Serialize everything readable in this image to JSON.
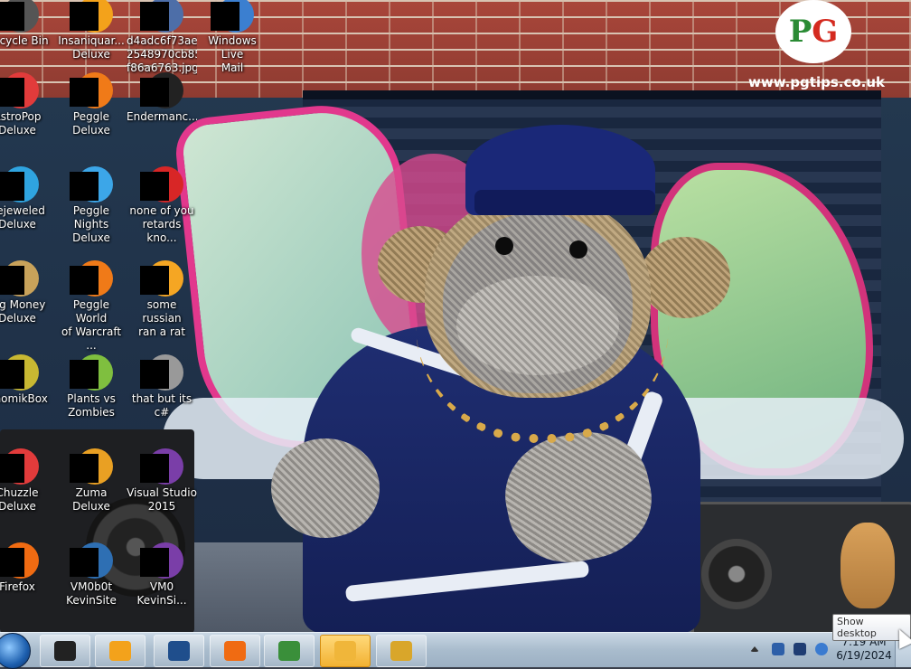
{
  "wallpaper": {
    "brand_logo_text": "PG tips",
    "brand_url": "www.pgtips.co.uk"
  },
  "desktop_icons": [
    {
      "label": "Recycle Bin",
      "icon": "recycle-bin-icon",
      "color": "#555555"
    },
    {
      "label": "Insaniquar...\nDeluxe",
      "icon": "insaniquarium-icon",
      "color": "#f3a21b"
    },
    {
      "label": "d4adc6f73ae5\n2548970cb85d\nf86a6763.jpg",
      "icon": "image-file-icon",
      "color": "#4d6ea8"
    },
    {
      "label": "Windows Live\nMail",
      "icon": "mail-icon",
      "color": "#3b7fd0"
    },
    {
      "label": "AstroPop\nDeluxe",
      "icon": "astropop-icon",
      "color": "#e23b3b"
    },
    {
      "label": "Peggle Deluxe",
      "icon": "peggle-icon",
      "color": "#f07a18"
    },
    {
      "label": "Endermanc...",
      "icon": "console-icon",
      "color": "#222222"
    },
    {
      "label": "Bejeweled\nDeluxe",
      "icon": "bejeweled-icon",
      "color": "#2fa4e0"
    },
    {
      "label": "Peggle Nights\nDeluxe",
      "icon": "peggle-nights-icon",
      "color": "#3ca6e8"
    },
    {
      "label": "none of you\nretards kno...",
      "icon": "opera-icon",
      "color": "#d82626"
    },
    {
      "label": "Big Money\nDeluxe",
      "icon": "big-money-icon",
      "color": "#c8a25a"
    },
    {
      "label": "Peggle World\nof Warcraft ...",
      "icon": "peggle-wow-icon",
      "color": "#f07a18"
    },
    {
      "label": "some russian\nran a rat",
      "icon": "script-file-icon",
      "color": "#f5a623"
    },
    {
      "label": "ChomikBox",
      "icon": "chomikbox-icon",
      "color": "#c8b832"
    },
    {
      "label": "Plants vs\nZombies",
      "icon": "pvz-icon",
      "color": "#7fbf3f"
    },
    {
      "label": "that but its c#",
      "icon": "files-icon",
      "color": "#999999"
    },
    {
      "label": "Chuzzle\nDeluxe",
      "icon": "chuzzle-icon",
      "color": "#e23b3b"
    },
    {
      "label": "Zuma Deluxe",
      "icon": "zuma-icon",
      "color": "#e9a023"
    },
    {
      "label": "Visual Studio\n2015",
      "icon": "visual-studio-icon",
      "color": "#7a3ea8"
    },
    {
      "label": "Firefox",
      "icon": "firefox-icon",
      "color": "#f06b12"
    },
    {
      "label": "VM0b0t\nKevinSite",
      "icon": "shortcut-icon",
      "color": "#2e6fb3"
    },
    {
      "label": "VM0\nKevinSi...",
      "icon": "visual-studio-icon",
      "color": "#7a3ea8"
    }
  ],
  "taskbar": {
    "start_label": "Start",
    "pinned": [
      {
        "name": "task-manager",
        "icon": "monitor-icon",
        "color": "#222222"
      },
      {
        "name": "media-player",
        "icon": "media-player-icon",
        "color": "#f3a21b"
      },
      {
        "name": "globe",
        "icon": "globe-icon",
        "color": "#1f4e8c"
      },
      {
        "name": "firefox",
        "icon": "firefox-icon",
        "color": "#f06b12"
      },
      {
        "name": "users",
        "icon": "users-icon",
        "color": "#3a8f3a"
      },
      {
        "name": "file-explorer",
        "icon": "folder-icon",
        "color": "#f0b63a",
        "active": true
      },
      {
        "name": "document",
        "icon": "document-icon",
        "color": "#d9a62a"
      }
    ],
    "tray_icons": [
      "show-hidden-icon",
      "network-icon",
      "display-icon",
      "wifi-icon"
    ],
    "clock_time": "7:19 AM",
    "clock_date": "6/19/2024",
    "show_desktop_tooltip": "Show desktop"
  }
}
